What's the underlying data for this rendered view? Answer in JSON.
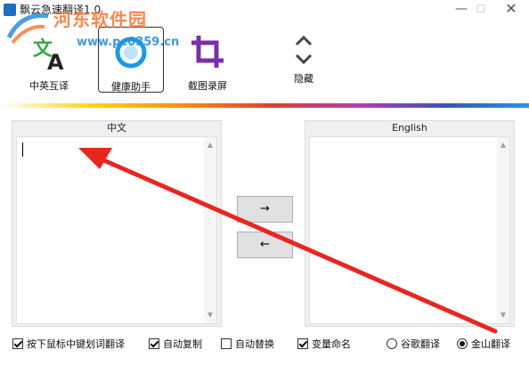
{
  "window": {
    "title": "飘云急速翻译1.0",
    "minimize_glyph": "—",
    "maximize_glyph": "☐",
    "close_glyph": "✕"
  },
  "watermark": {
    "line1": "河东软件园",
    "line2": "www.pc0359.cn"
  },
  "toolbar": {
    "translate_label": "中英互译",
    "health_label": "健康助手",
    "capture_label": "截图录屏",
    "hide_label": "隐藏"
  },
  "source_panel": {
    "header": "中文",
    "text": ""
  },
  "target_panel": {
    "header": "English",
    "text": ""
  },
  "actions": {
    "translate_forward": "→",
    "translate_backward": "←"
  },
  "options": [
    {
      "label": "按下鼠标中键划词翻译",
      "checked": true
    },
    {
      "label": "自动复制",
      "checked": true
    },
    {
      "label": "自动替换",
      "checked": false
    },
    {
      "label": "变量命名",
      "checked": true
    }
  ],
  "engines": [
    {
      "label": "谷歌翻译",
      "selected": false
    },
    {
      "label": "金山翻译",
      "selected": true
    }
  ],
  "colors": {
    "accent_blue": "#1a9be6",
    "crop_purple": "#7b2fa8",
    "translate_green": "#3aa845",
    "annotation_red": "#e8261f"
  }
}
